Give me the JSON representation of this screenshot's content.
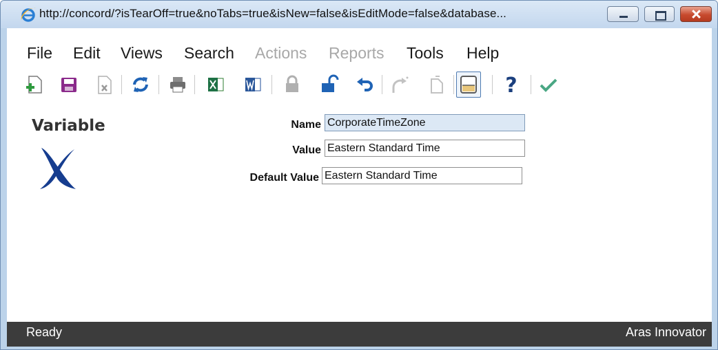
{
  "window": {
    "url": "http://concord/?isTearOff=true&noTabs=true&isNew=false&isEditMode=false&database...",
    "browser_icon": "ie-icon"
  },
  "menu": [
    {
      "label": "File",
      "enabled": true
    },
    {
      "label": "Edit",
      "enabled": true
    },
    {
      "label": "Views",
      "enabled": true
    },
    {
      "label": "Search",
      "enabled": true
    },
    {
      "label": "Actions",
      "enabled": false
    },
    {
      "label": "Reports",
      "enabled": false
    },
    {
      "label": "Tools",
      "enabled": true
    },
    {
      "label": "Help",
      "enabled": true
    }
  ],
  "toolbar": {
    "icons": [
      "new-item-icon",
      "save-icon",
      "delete-icon",
      "refresh-icon",
      "print-icon",
      "excel-export-icon",
      "word-export-icon",
      "lock-icon",
      "unlock-icon",
      "undo-icon",
      "promote-icon",
      "copy-icon",
      "form-view-icon",
      "help-icon",
      "done-icon"
    ],
    "colors": {
      "green": "#2e9a3e",
      "purple": "#8b2a8b",
      "blue": "#1f63b5",
      "gray": "#9a9a9a",
      "teal": "#4aa784"
    }
  },
  "item": {
    "type_label": "Variable",
    "type_icon": "variable-x-icon",
    "icon_color": "#163d8f"
  },
  "form": {
    "name_label": "Name",
    "name_value": "CorporateTimeZone",
    "value_label": "Value",
    "value_value": "Eastern Standard Time",
    "default_label": "Default Value",
    "default_value": "Eastern Standard Time"
  },
  "status": {
    "left": "Ready",
    "right": "Aras Innovator"
  }
}
